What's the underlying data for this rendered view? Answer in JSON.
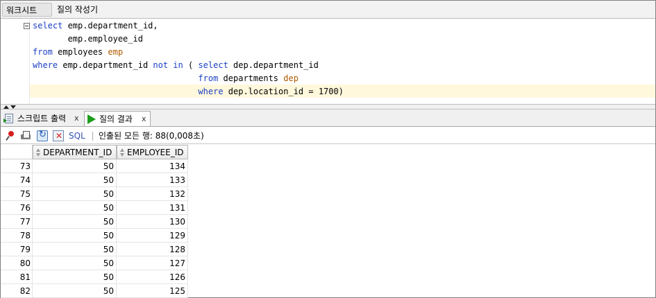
{
  "top_tabs": [
    "워크시트",
    "질의 작성기"
  ],
  "editor": {
    "lines": [
      [
        [
          "kw",
          "select"
        ],
        [
          "t",
          " emp.department_id,"
        ]
      ],
      [
        [
          "t",
          "       emp.employee_id"
        ]
      ],
      [
        [
          "kw",
          "from"
        ],
        [
          "t",
          " employees "
        ],
        [
          "al",
          "emp"
        ]
      ],
      [
        [
          "kw",
          "where"
        ],
        [
          "t",
          " emp.department_id "
        ],
        [
          "kw",
          "not in"
        ],
        [
          "t",
          " ( "
        ],
        [
          "kw",
          "select"
        ],
        [
          "t",
          " dep.department_id"
        ]
      ],
      [
        [
          "t",
          "                                 "
        ],
        [
          "kw",
          "from"
        ],
        [
          "t",
          " departments "
        ],
        [
          "al",
          "dep"
        ]
      ],
      [
        [
          "t",
          "                                 "
        ],
        [
          "kw",
          "where"
        ],
        [
          "t",
          " dep.location_id = "
        ],
        [
          "num",
          "1700"
        ],
        [
          "t",
          ")"
        ]
      ]
    ]
  },
  "result_tabs": {
    "script_output": "스크립트 출력",
    "query_result": "질의 결과",
    "close": "x"
  },
  "toolbar": {
    "sql_label": "SQL",
    "status": "인출된 모든 행: 88(0,008초)"
  },
  "grid": {
    "columns": [
      "DEPARTMENT_ID",
      "EMPLOYEE_ID"
    ],
    "rows": [
      [
        "73",
        "50",
        "134"
      ],
      [
        "74",
        "50",
        "133"
      ],
      [
        "75",
        "50",
        "132"
      ],
      [
        "76",
        "50",
        "131"
      ],
      [
        "77",
        "50",
        "130"
      ],
      [
        "78",
        "50",
        "129"
      ],
      [
        "79",
        "50",
        "128"
      ],
      [
        "80",
        "50",
        "127"
      ],
      [
        "81",
        "50",
        "126"
      ],
      [
        "82",
        "50",
        "125"
      ]
    ]
  }
}
